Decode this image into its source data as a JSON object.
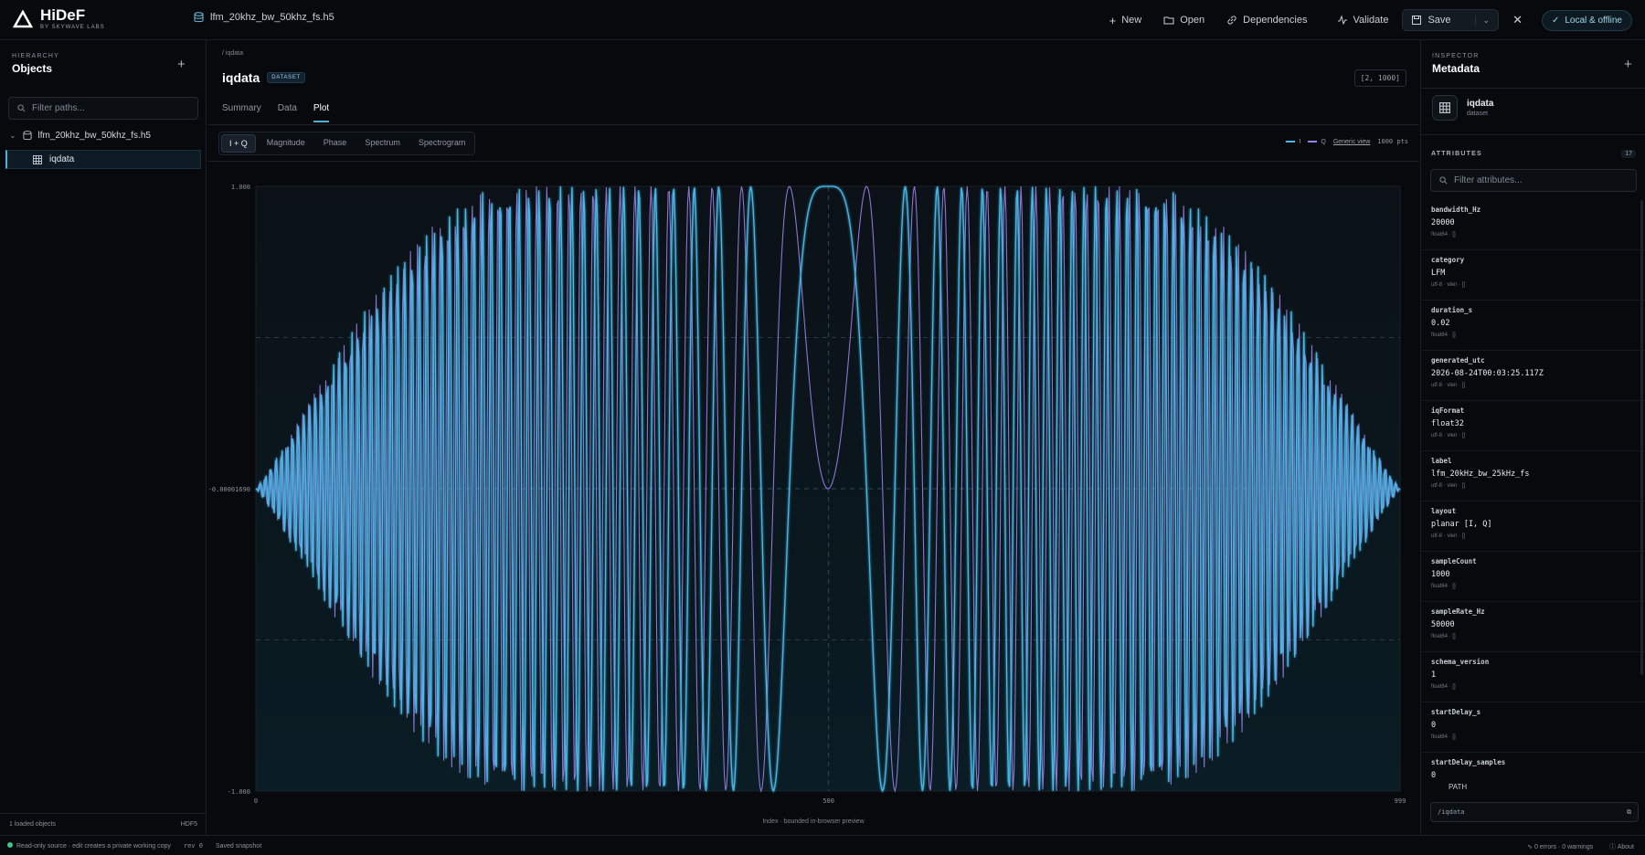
{
  "app": {
    "name": "HiDeF",
    "subtitle": "BY SKYWAVE LABS"
  },
  "file_tab": {
    "name": "lfm_20khz_bw_50khz_fs.h5"
  },
  "toolbar": {
    "new_label": "New",
    "open_label": "Open",
    "dependencies_label": "Dependencies",
    "validate_label": "Validate",
    "save_label": "Save",
    "mode_label": "Local & offline"
  },
  "hierarchy": {
    "section_label": "HIERARCHY",
    "title": "Objects",
    "filter_placeholder": "Filter paths...",
    "file_node": "lfm_20khz_bw_50khz_fs.h5",
    "dataset_node": "iqdata",
    "footer_count": "1 loaded objects",
    "footer_format": "HDF5"
  },
  "main": {
    "breadcrumb": "/ iqdata",
    "title": "iqdata",
    "badge": "DATASET",
    "shape": "[2, 1000]",
    "tabs": [
      {
        "label": "Summary"
      },
      {
        "label": "Data"
      },
      {
        "label": "Plot"
      }
    ],
    "views": [
      {
        "label": "I + Q"
      },
      {
        "label": "Magnitude"
      },
      {
        "label": "Phase"
      },
      {
        "label": "Spectrum"
      },
      {
        "label": "Spectrogram"
      }
    ],
    "legend": {
      "i_label": "I",
      "q_label": "Q",
      "view_link": "Generic view",
      "points": "1000 pts"
    },
    "x_caption": "Index · bounded in-browser preview"
  },
  "chart_data": {
    "type": "line",
    "xlabel": "Index · bounded in-browser preview",
    "xlim": [
      0,
      999
    ],
    "ylim": [
      -1.0,
      1.0
    ],
    "x_ticks": [
      "0",
      "500",
      "999"
    ],
    "y_ticks": [
      "1.000",
      "-0.00001690",
      "-1.000"
    ],
    "series": [
      {
        "name": "I",
        "color": "#4ab8e8",
        "description_function": "taper(n)*cos(pi*k*((n-499.5)^2))",
        "n_points": 1000
      },
      {
        "name": "Q",
        "color": "#9b7fe6",
        "description_function": "taper(n)*sin(pi*k*((n-499.5)^2))",
        "n_points": 1000
      }
    ]
  },
  "inspector": {
    "section_label": "INSPECTOR",
    "title": "Metadata",
    "object_name": "iqdata",
    "object_kind": "dataset",
    "attributes_label": "ATTRIBUTES",
    "attributes_count": "17",
    "filter_placeholder": "Filter attributes...",
    "attributes": [
      {
        "key": "bandwidth_Hz",
        "value": "20000",
        "type": "float64 · []"
      },
      {
        "key": "category",
        "value": "LFM",
        "type": "utf-8 · vlen · []"
      },
      {
        "key": "duration_s",
        "value": "0.02",
        "type": "float64 · []"
      },
      {
        "key": "generated_utc",
        "value": "2026-08-24T00:03:25.117Z",
        "type": "utf-8 · vlen · []"
      },
      {
        "key": "iqFormat",
        "value": "float32",
        "type": "utf-8 · vlen · []"
      },
      {
        "key": "label",
        "value": "lfm_20kHz_bw_25kHz_fs",
        "type": "utf-8 · vlen · []"
      },
      {
        "key": "layout",
        "value": "planar [I, Q]",
        "type": "utf-8 · vlen · []"
      },
      {
        "key": "sampleCount",
        "value": "1000",
        "type": "float64 · []"
      },
      {
        "key": "sampleRate_Hz",
        "value": "50000",
        "type": "float64 · []"
      },
      {
        "key": "schema_version",
        "value": "1",
        "type": "float64 · []"
      },
      {
        "key": "startDelay_s",
        "value": "0",
        "type": "float64 · []"
      },
      {
        "key": "startDelay_samples",
        "value": "0",
        "type": "float64 · []"
      }
    ],
    "path_label": "PATH",
    "path_value": "/iqdata"
  },
  "status": {
    "readonly": "Read-only source · edit creates a private working copy",
    "rev": "rev 0",
    "snapshot": "Saved snapshot",
    "validation": "0 errors · 0 warnings",
    "about": "About"
  }
}
